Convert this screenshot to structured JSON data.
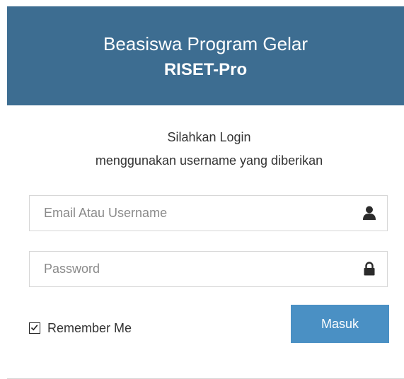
{
  "header": {
    "title": "Beasiswa Program Gelar",
    "subtitle": "RISET-Pro",
    "background_color": "#3d6d91"
  },
  "intro": {
    "line1": "Silahkan Login",
    "line2": "menggunakan username yang diberikan"
  },
  "form": {
    "username": {
      "placeholder": "Email Atau Username",
      "value": "",
      "icon": "user-icon"
    },
    "password": {
      "placeholder": "Password",
      "value": "",
      "icon": "lock-icon"
    },
    "remember": {
      "label": "Remember Me",
      "checked": true
    },
    "submit": {
      "label": "Masuk",
      "color": "#4a90c4"
    }
  }
}
